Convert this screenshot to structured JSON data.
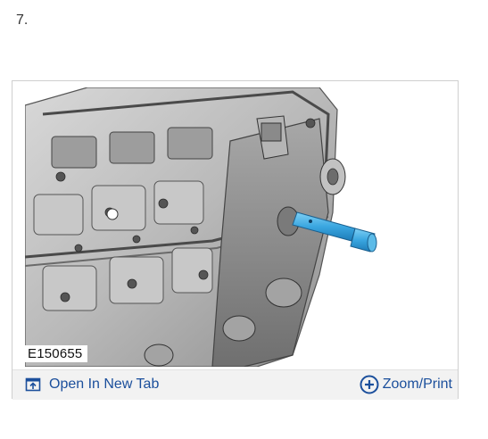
{
  "step": {
    "number": "7."
  },
  "figure": {
    "label": "E150655",
    "image_alt": "illustration-engine-cylinder-head-with-blue-tool"
  },
  "toolbar": {
    "open_tab_label": "Open In New Tab",
    "open_tab_icon": "open-in-new-tab-icon",
    "zoom_print_label": "Zoom/Print",
    "zoom_print_icon": "circle-plus-icon"
  },
  "colors": {
    "link": "#1b4f9c",
    "toolbar_bg": "#f2f2f2",
    "tool_highlight": "#3aa6e0"
  }
}
